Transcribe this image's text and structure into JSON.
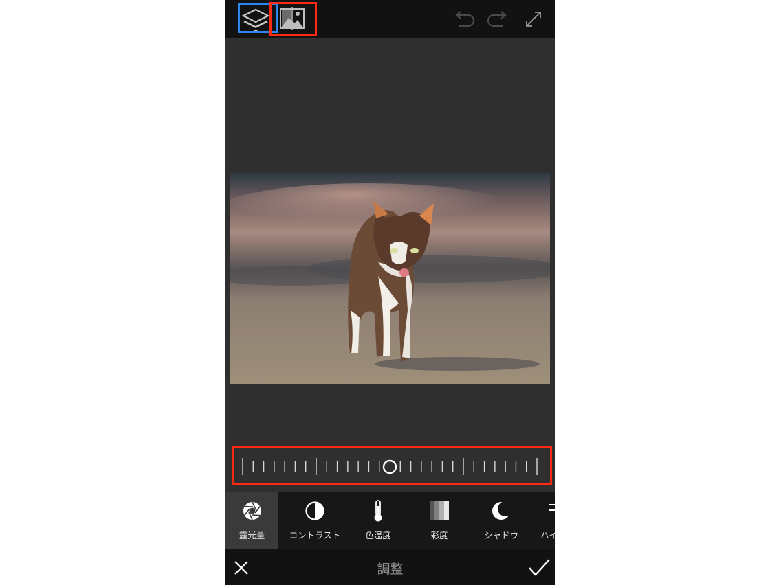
{
  "app": {
    "header": {
      "icons": [
        "layers-icon",
        "compare-icon",
        "undo-icon",
        "redo-icon",
        "fullscreen-icon"
      ]
    },
    "tools": [
      {
        "label": "露光量",
        "icon": "aperture-icon",
        "active": true
      },
      {
        "label": "コントラスト",
        "icon": "contrast-icon",
        "active": false
      },
      {
        "label": "色温度",
        "icon": "thermometer-icon",
        "active": false
      },
      {
        "label": "彩度",
        "icon": "saturation-icon",
        "active": false
      },
      {
        "label": "シャドウ",
        "icon": "moon-icon",
        "active": false
      },
      {
        "label": "ハイ",
        "icon": "highlight-icon",
        "active": false
      }
    ],
    "footer": {
      "title": "調整",
      "cancel_icon": "close-icon",
      "confirm_icon": "check-icon"
    },
    "slider": {
      "value": 0.5
    },
    "colors": {
      "highlight_blue": "#2b86f0",
      "highlight_red": "#ff2a14"
    }
  }
}
